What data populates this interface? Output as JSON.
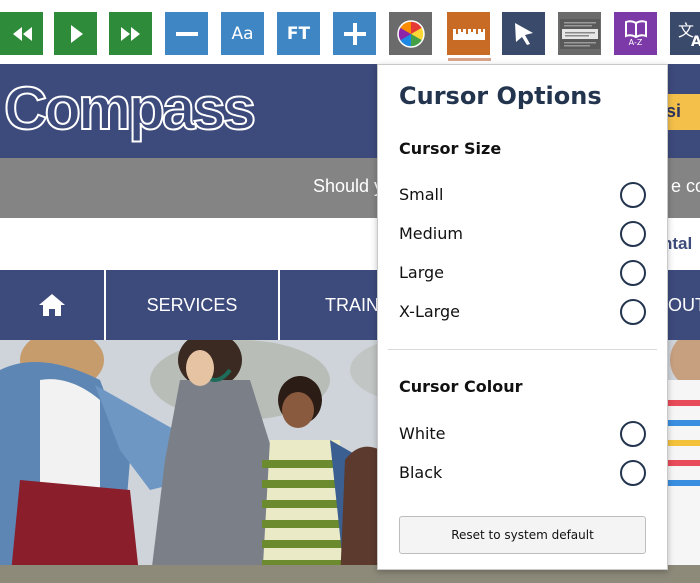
{
  "toolbar": {
    "text_size_label": "Aa",
    "font_label": "FT",
    "buttons": [
      {
        "name": "rewind",
        "icon": "rewind-icon"
      },
      {
        "name": "play",
        "icon": "play-icon"
      },
      {
        "name": "fast-forward",
        "icon": "fast-forward-icon"
      },
      {
        "name": "decrease",
        "icon": "minus-icon"
      },
      {
        "name": "text-size",
        "icon": "text-size-icon"
      },
      {
        "name": "font",
        "icon": "font-icon"
      },
      {
        "name": "increase",
        "icon": "plus-icon"
      },
      {
        "name": "colour",
        "icon": "colour-wheel-icon"
      },
      {
        "name": "ruler",
        "icon": "ruler-icon"
      },
      {
        "name": "cursor",
        "icon": "cursor-arrow-icon"
      },
      {
        "name": "screen-mask",
        "icon": "screen-mask-icon"
      },
      {
        "name": "dictionary",
        "icon": "dictionary-icon"
      },
      {
        "name": "translate",
        "icon": "translate-icon"
      }
    ],
    "dictionary_caption": "A-Z",
    "colors": {
      "green": "#2e8b3a",
      "blue": "#3f86c4",
      "grey": "#6b6b6b",
      "orange": "#c76b25",
      "navy": "#3a4a6b",
      "purple": "#7c3aa8"
    }
  },
  "site": {
    "logo_text": "Compass",
    "accessibility_label": "essi",
    "notice_left": "Should y",
    "notice_right": "e co",
    "strip_text": "ntal",
    "brand_color": "#3d4a7c",
    "nav": {
      "home_icon": "home-icon",
      "items": [
        "SERVICES",
        "TRAIN",
        "OUT"
      ]
    }
  },
  "popup": {
    "title": "Cursor Options",
    "size_section": {
      "title": "Cursor Size",
      "options": [
        "Small",
        "Medium",
        "Large",
        "X-Large"
      ]
    },
    "colour_section": {
      "title": "Cursor Colour",
      "options": [
        "White",
        "Black"
      ]
    },
    "reset_label": "Reset to system default"
  }
}
